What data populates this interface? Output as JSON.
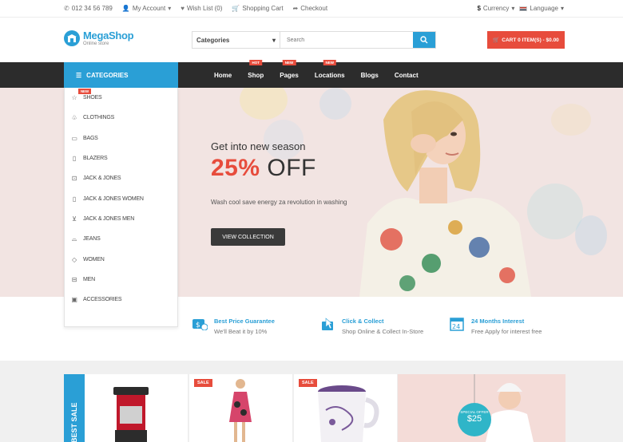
{
  "topbar": {
    "phone": "012 34 56 789",
    "account": "My Account",
    "wishlist": "Wish List (0)",
    "cart": "Shopping Cart",
    "checkout": "Checkout",
    "currency": "Currency",
    "language": "Language"
  },
  "header": {
    "logo_name": "MegaShop",
    "logo_tagline": "Online store",
    "search_category": "Categories",
    "search_placeholder": "Search",
    "cart_label": "CART 0 ITEM(S) - $0.00"
  },
  "nav": {
    "categories_label": "CATEGORIES",
    "items": [
      {
        "label": "Home",
        "badge": ""
      },
      {
        "label": "Shop",
        "badge": "HOT"
      },
      {
        "label": "Pages",
        "badge": "NEW"
      },
      {
        "label": "Locations",
        "badge": "NEW"
      },
      {
        "label": "Blogs",
        "badge": ""
      },
      {
        "label": "Contact",
        "badge": ""
      }
    ]
  },
  "sidebar": {
    "items": [
      {
        "label": "SHOES",
        "icon": "shoe-icon",
        "badge": "NEW"
      },
      {
        "label": "CLOTHINGS",
        "icon": "clothing-icon",
        "badge": ""
      },
      {
        "label": "BAGS",
        "icon": "bag-icon",
        "badge": ""
      },
      {
        "label": "BLAZERS",
        "icon": "blazer-icon",
        "badge": ""
      },
      {
        "label": "JACK & JONES",
        "icon": "shirt-icon",
        "badge": ""
      },
      {
        "label": "JACK & JONES WOMEN",
        "icon": "phone-icon",
        "badge": ""
      },
      {
        "label": "JACK & JONES MEN",
        "icon": "cart-icon",
        "badge": ""
      },
      {
        "label": "JEANS",
        "icon": "hat-icon",
        "badge": ""
      },
      {
        "label": "WOMEN",
        "icon": "diamond-icon",
        "badge": ""
      },
      {
        "label": "MEN",
        "icon": "hdd-icon",
        "badge": ""
      },
      {
        "label": "ACCESSORIES",
        "icon": "briefcase-icon",
        "badge": ""
      }
    ]
  },
  "hero": {
    "title": "Get into new season",
    "percent": "25%",
    "off": "OFF",
    "subtitle": "Wash cool save energy za revolution in washing",
    "button": "VIEW COLLECTION"
  },
  "features": [
    {
      "title": "Best Price Guarantee",
      "desc": "We'll Beat it by 10%",
      "icon": "price-tag-icon"
    },
    {
      "title": "Click & Collect",
      "desc": "Shop Online & Collect In-Store",
      "icon": "cursor-icon"
    },
    {
      "title": "24 Months Interest",
      "desc": "Free Apply for interest free",
      "icon": "calendar-icon"
    }
  ],
  "products": {
    "best_sale_label": "BEST SALE",
    "sale_badge": "SALE",
    "offer_label": "SPECIAL OFFER",
    "offer_price": "$25"
  },
  "colors": {
    "accent": "#2a9fd6",
    "danger": "#e74c3c",
    "nav_bg": "#2c2c2c"
  }
}
